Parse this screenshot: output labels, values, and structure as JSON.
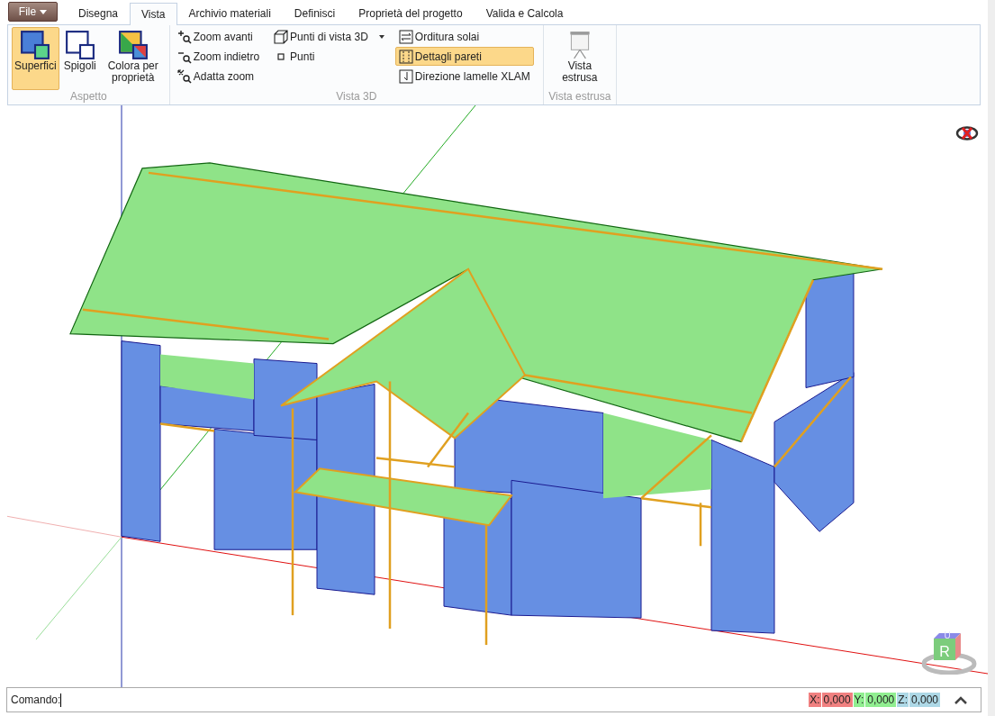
{
  "ribbon": {
    "app_menu": {
      "label": "File"
    },
    "tabs": [
      {
        "label": "Disegna",
        "selected": false
      },
      {
        "label": "Vista",
        "selected": true
      },
      {
        "label": "Archivio materiali",
        "selected": false
      },
      {
        "label": "Definisci",
        "selected": false
      },
      {
        "label": "Proprietà del progetto",
        "selected": false
      },
      {
        "label": "Valida e Calcola",
        "selected": false
      }
    ],
    "groups": [
      {
        "title": "Aspetto",
        "kind": "large",
        "items": [
          {
            "label": "Superfici",
            "selected": true
          },
          {
            "label": "Spigoli",
            "selected": false
          },
          {
            "label": "Colora per proprietà",
            "selected": false
          }
        ]
      },
      {
        "title": "Vista 3D",
        "kind": "small",
        "columns": [
          [
            {
              "label": "Zoom avanti",
              "selected": false,
              "dropdown": false
            },
            {
              "label": "Zoom indietro",
              "selected": false,
              "dropdown": false
            },
            {
              "label": "Adatta zoom",
              "selected": false,
              "dropdown": false
            }
          ],
          [
            {
              "label": "Punti di vista 3D",
              "selected": false,
              "dropdown": true
            },
            {
              "label": "Punti",
              "selected": false,
              "dropdown": false
            }
          ],
          [
            {
              "label": "Orditura solai",
              "selected": false,
              "dropdown": false
            },
            {
              "label": "Dettagli pareti",
              "selected": true,
              "dropdown": false
            },
            {
              "label": "Direzione lamelle XLAM",
              "selected": false,
              "dropdown": false
            }
          ]
        ]
      },
      {
        "title": "Vista estrusa",
        "kind": "large",
        "items": [
          {
            "label": "Vista estrusa",
            "selected": false
          }
        ]
      }
    ]
  },
  "viewport": {
    "view_cube": {
      "front": "R",
      "top": "U"
    }
  },
  "command_bar": {
    "label": "Comando:",
    "coordinates": [
      {
        "axis": "X:",
        "value": "0,000",
        "color": "#f08080"
      },
      {
        "axis": "Y:",
        "value": "0,000",
        "color": "#90ee90"
      },
      {
        "axis": "Z:",
        "value": "0,000",
        "color": "#add8e6"
      }
    ]
  }
}
